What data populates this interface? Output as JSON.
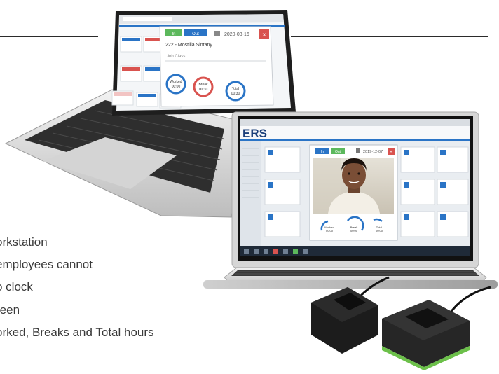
{
  "bullets": [
    "orkstation",
    "employees cannot",
    "o clock",
    "reen",
    "orked, Breaks and Total hours"
  ],
  "laptop_back": {
    "in_label": "In",
    "out_label": "Out",
    "date": "2020-03-16",
    "employee": "222 - Mostilla Sintany",
    "job_class": "Job Class",
    "gauges": [
      {
        "label": "Worked",
        "value": "00:00"
      },
      {
        "label": "Break",
        "value": "00:30"
      },
      {
        "label": "Total",
        "value": "00:30"
      }
    ]
  },
  "laptop_front": {
    "logo": "ERS",
    "in_label": "In",
    "out_label": "Out",
    "date": "2019-12-07",
    "gauges": [
      {
        "label": "Worked",
        "value": "00:00"
      },
      {
        "label": "Break",
        "value": "00:00"
      },
      {
        "label": "Total",
        "value": "00:00"
      }
    ]
  },
  "colors": {
    "accent_blue": "#2a74c6",
    "accent_green": "#5cb85c",
    "alert_red": "#d9534f",
    "dark_device": "#1c1c1c"
  }
}
